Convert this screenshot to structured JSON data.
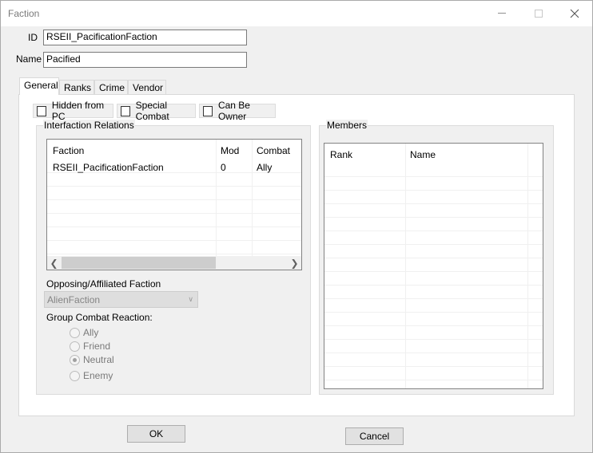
{
  "window": {
    "title": "Faction"
  },
  "form": {
    "id_label": "ID",
    "id_value": "RSEII_PacificationFaction",
    "name_label": "Name",
    "name_value": "Pacified"
  },
  "tabs": [
    {
      "label": "General",
      "active": true
    },
    {
      "label": "Ranks",
      "active": false
    },
    {
      "label": "Crime",
      "active": false
    },
    {
      "label": "Vendor",
      "active": false
    }
  ],
  "checkboxes": [
    {
      "label": "Hidden from PC",
      "checked": false
    },
    {
      "label": "Special Combat",
      "checked": false
    },
    {
      "label": "Can Be Owner",
      "checked": false
    }
  ],
  "interfaction": {
    "group_label": "Interfaction Relations",
    "columns": [
      "Faction",
      "Mod",
      "Combat"
    ],
    "rows": [
      [
        "RSEII_PacificationFaction",
        "0",
        "Ally"
      ]
    ]
  },
  "members": {
    "group_label": "Members",
    "columns": [
      "Rank",
      "Name"
    ]
  },
  "opposing": {
    "label": "Opposing/Affiliated Faction",
    "value": "AlienFaction"
  },
  "group_combat": {
    "label": "Group Combat Reaction:",
    "options": [
      "Ally",
      "Friend",
      "Neutral",
      "Enemy"
    ],
    "selected": "Neutral"
  },
  "buttons": {
    "ok": "OK",
    "cancel": "Cancel"
  },
  "icons": {
    "minimize": "minimize-icon",
    "maximize": "maximize-icon",
    "close": "close-icon",
    "scroll_left": "chevron-left-icon",
    "scroll_right": "chevron-right-icon",
    "dropdown": "chevron-down-icon"
  }
}
